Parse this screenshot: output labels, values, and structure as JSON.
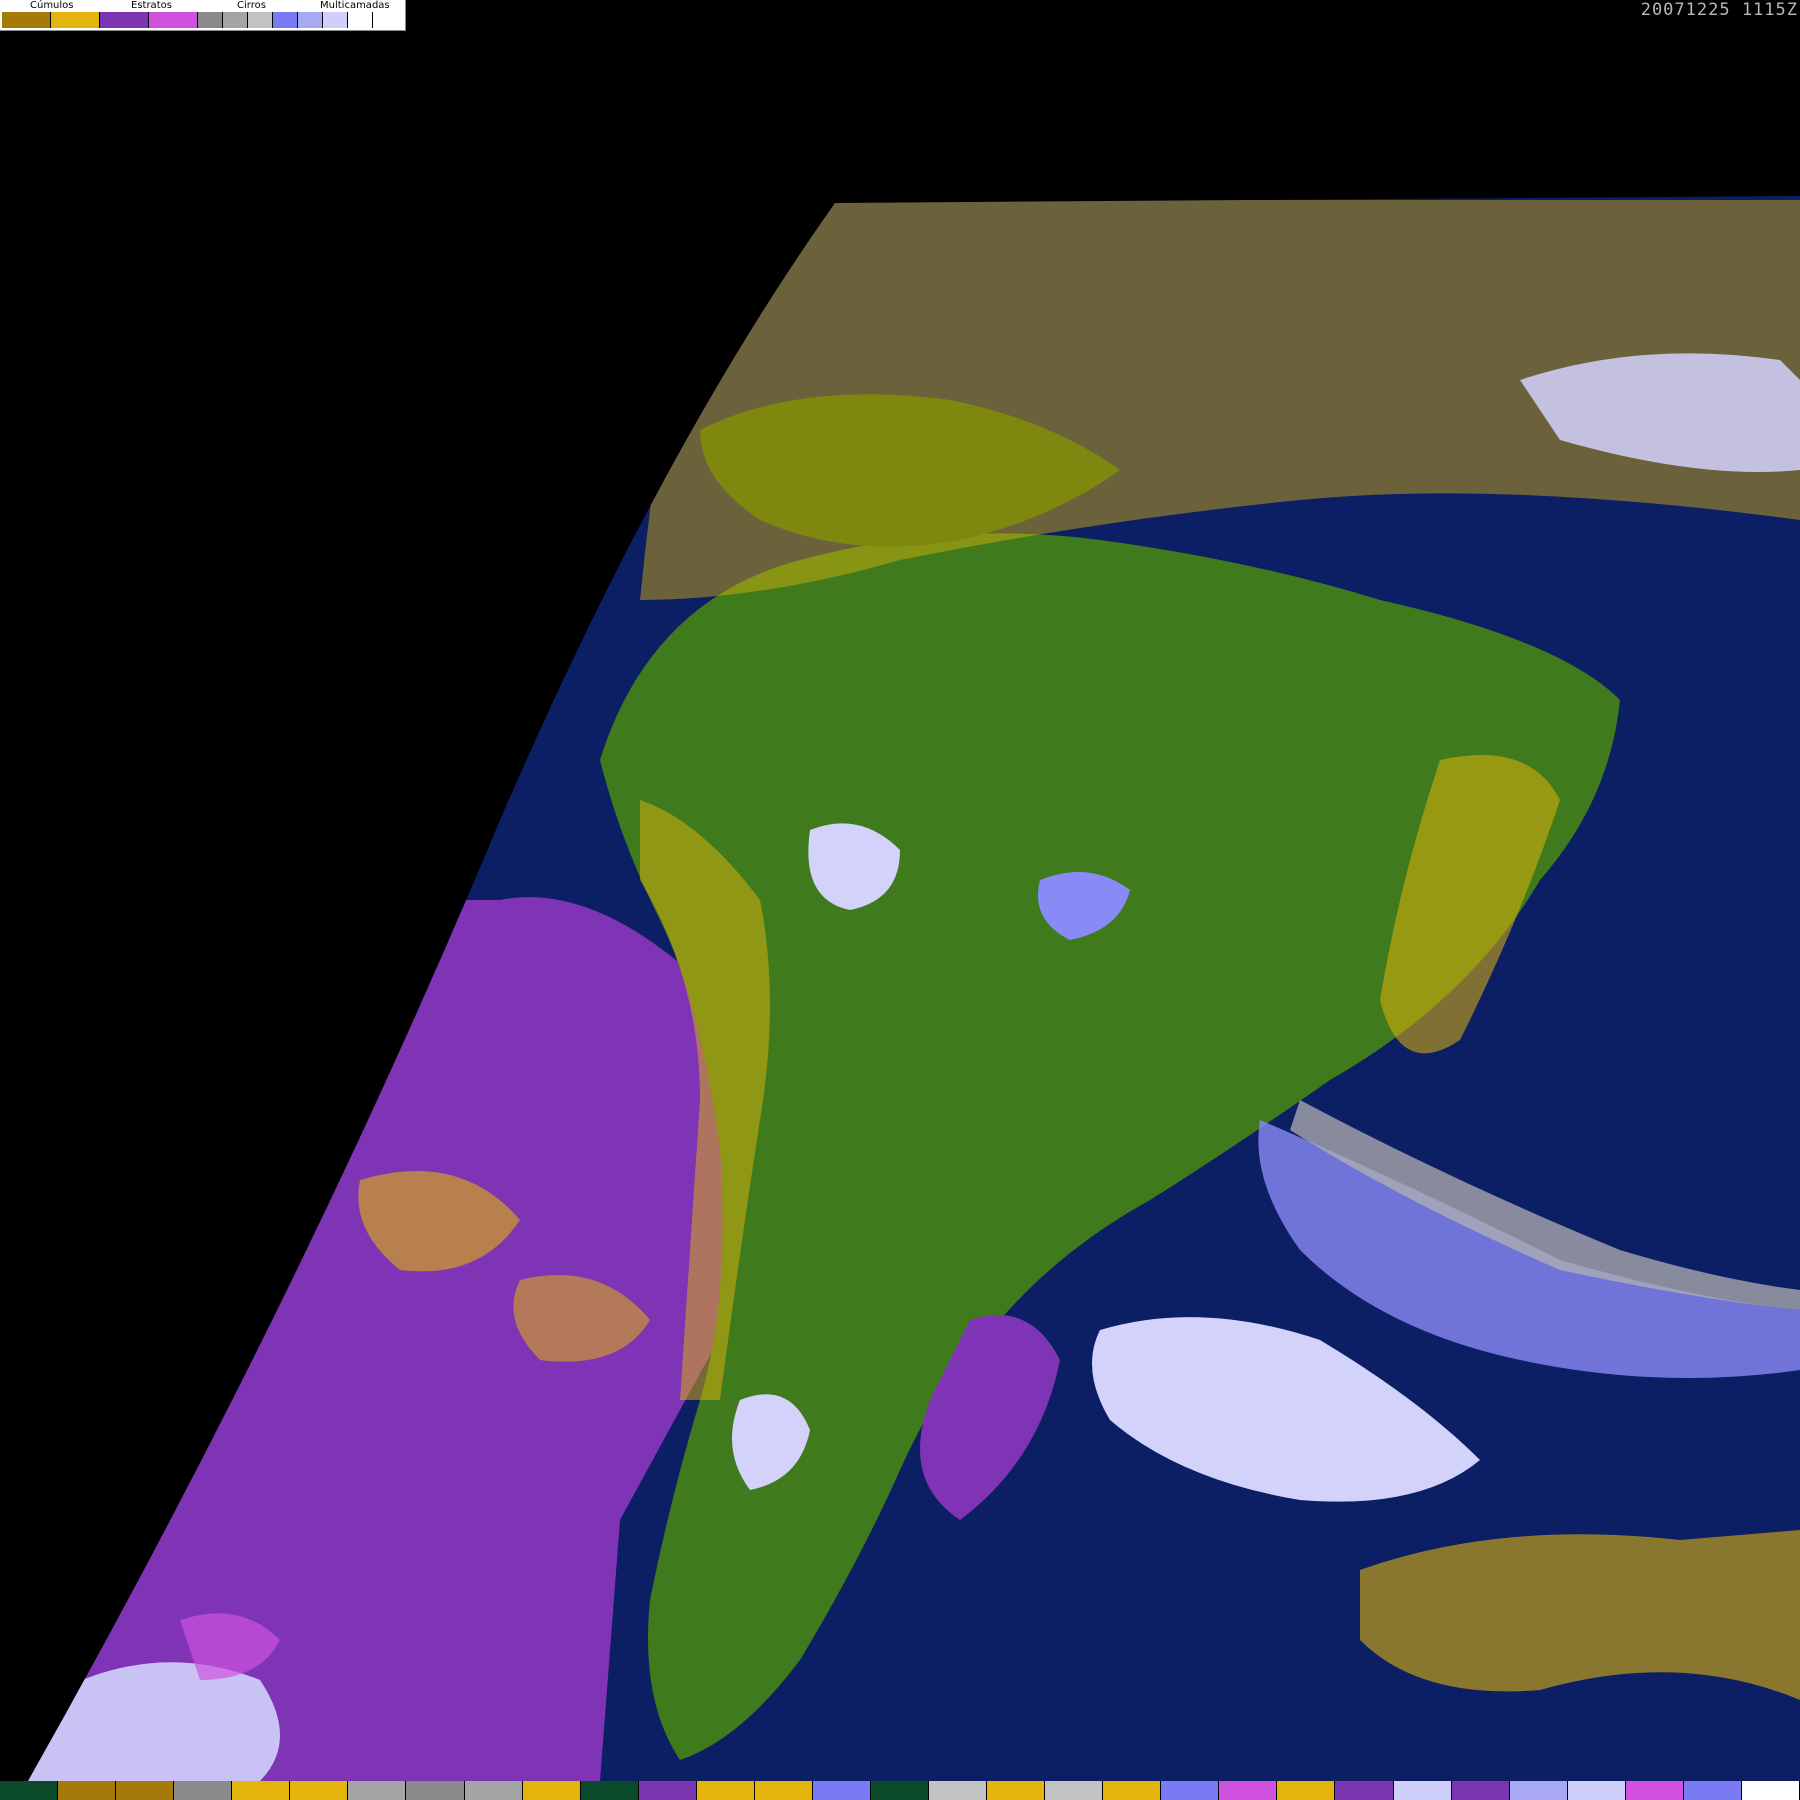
{
  "legend": {
    "categories": [
      {
        "label": "Cúmulos",
        "colors": [
          "#a57a0a",
          "#e2b40c"
        ]
      },
      {
        "label": "Estratos",
        "colors": [
          "#7b35b3",
          "#d050e0"
        ]
      },
      {
        "label": "Cirros",
        "colors": [
          "#8a8a8a",
          "#a4a4a4",
          "#c2c2c2"
        ]
      },
      {
        "label": "Multicamadas",
        "colors": [
          "#7a7af4",
          "#a8a8f4",
          "#cfcffb",
          "#ffffff"
        ]
      }
    ]
  },
  "timestamp": "20071225 1115Z",
  "colors": {
    "ocean": "#0c1f64",
    "land": "#3f7a1c",
    "land_dark": "#2f6412",
    "stratus": "#7e34b4",
    "stratus_light": "#cf52df",
    "cumulus": "#e0b30c",
    "cumulus_dark": "#a5790a",
    "cirrus": "#b0b0b0",
    "multilayer": "#8a8af6",
    "multilayer_light": "#d2d2fb",
    "space": "#000000"
  },
  "bottom_strip": [
    "#0a4a2a",
    "#a57a0a",
    "#a57a0a",
    "#8a8a8a",
    "#e2b40c",
    "#e2b40c",
    "#a4a4a4",
    "#8a8a8a",
    "#a4a4a4",
    "#e2b40c",
    "#0a4a2a",
    "#7b35b3",
    "#e2b40c",
    "#e2b40c",
    "#7a7af4",
    "#0a4a2a",
    "#c2c2c2",
    "#e2b40c",
    "#c2c2c2",
    "#e2b40c",
    "#7a7af4",
    "#d050e0",
    "#e2b40c",
    "#7b35b3",
    "#cfcffb",
    "#7b35b3",
    "#a8a8f4",
    "#cfcffb",
    "#d050e0",
    "#7a7af4",
    "#ffffff"
  ]
}
